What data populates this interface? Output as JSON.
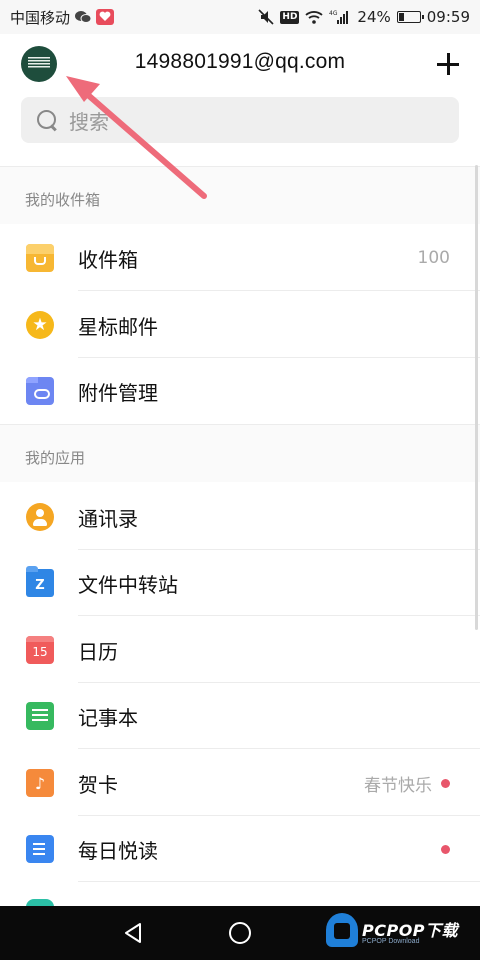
{
  "status_bar": {
    "carrier": "中国移动",
    "network": "4G",
    "hd_label": "HD",
    "battery_percent": "24%",
    "battery_level": 0.24,
    "time": "09:59"
  },
  "header": {
    "account_email": "1498801991@qq.com"
  },
  "search": {
    "placeholder": "搜索"
  },
  "sections": {
    "inbox_section": {
      "title": "我的收件箱",
      "items": [
        {
          "label": "收件箱",
          "count": "100",
          "icon": "inbox-icon"
        },
        {
          "label": "星标邮件",
          "icon": "star-icon"
        },
        {
          "label": "附件管理",
          "icon": "attachment-icon"
        }
      ]
    },
    "apps_section": {
      "title": "我的应用",
      "items": [
        {
          "label": "通讯录",
          "icon": "contacts-icon"
        },
        {
          "label": "文件中转站",
          "icon": "folder-icon",
          "icon_text": "Z"
        },
        {
          "label": "日历",
          "icon": "calendar-icon",
          "icon_text": "15"
        },
        {
          "label": "记事本",
          "icon": "notes-icon"
        },
        {
          "label": "贺卡",
          "meta": "春节快乐",
          "badge": "unread-dot",
          "icon": "greeting-card-icon",
          "icon_text": "♪"
        },
        {
          "label": "每日悦读",
          "badge": "unread-dot",
          "icon": "daily-read-icon"
        }
      ]
    }
  },
  "nav_bar": {
    "logo_text": "PCPOP下载",
    "logo_sub": "PCPOP Download"
  },
  "colors": {
    "accent_red": "#e8566b",
    "annotation_arrow": "#ee6b7a"
  }
}
